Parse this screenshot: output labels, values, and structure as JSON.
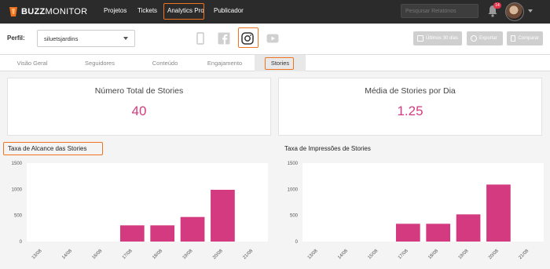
{
  "app": {
    "logo_text_bold": "BUZZ",
    "logo_text": "MONITOR"
  },
  "nav": {
    "items": [
      "Projetos",
      "Tickets",
      "Analytics Pro",
      "Publicador"
    ],
    "active": "Analytics Pro"
  },
  "search": {
    "placeholder": "Pesquisar Relatórios"
  },
  "notifications": {
    "count": "14"
  },
  "profile": {
    "label": "Perfil:",
    "selected": "siluetsjardins"
  },
  "networks": [
    "instagram-stories-icon",
    "facebook-icon",
    "instagram-icon",
    "youtube-icon"
  ],
  "toolbar": {
    "period": "Últimos 30 dias",
    "export": "Exportar",
    "compare": "Comparar"
  },
  "tabs": [
    "Visão Geral",
    "Seguidores",
    "Conteúdo",
    "Engajamento",
    "Stories"
  ],
  "active_tab": "Stories",
  "cards": [
    {
      "title": "Número Total de Stories",
      "value": "40"
    },
    {
      "title": "Média de Stories por Dia",
      "value": "1.25"
    }
  ],
  "colors": {
    "accent": "#d33a80",
    "highlight": "#f07320",
    "topbar": "#2b2b2b"
  },
  "chart_data": [
    {
      "type": "bar",
      "title": "Taxa de Alcance das Stories",
      "categories": [
        "13/08",
        "14/08",
        "16/08",
        "17/08",
        "18/08",
        "19/08",
        "20/08",
        "21/08"
      ],
      "values": [
        0,
        0,
        0,
        310,
        310,
        470,
        990,
        0
      ],
      "ylim": [
        0,
        1500
      ],
      "yticks": [
        0,
        500,
        1000,
        1500
      ],
      "grid": false
    },
    {
      "type": "bar",
      "title": "Taxa de Impressões de Stories",
      "categories": [
        "13/08",
        "14/08",
        "15/08",
        "17/08",
        "18/08",
        "19/08",
        "20/08",
        "21/08"
      ],
      "values": [
        0,
        0,
        0,
        340,
        340,
        520,
        1090,
        0
      ],
      "ylim": [
        0,
        1500
      ],
      "yticks": [
        0,
        500,
        1000,
        1500
      ],
      "grid": false
    }
  ]
}
